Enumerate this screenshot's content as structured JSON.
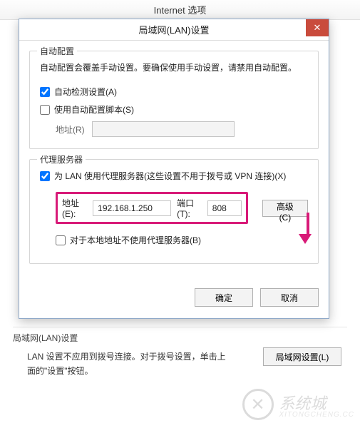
{
  "parent": {
    "title": "Internet 选项",
    "lan_section_label": "局域网(LAN)设置",
    "lan_desc": "LAN 设置不应用到拨号连接。对于拨号设置，单击上面的\"设置\"按钮。",
    "lan_button": "局域网设置(L)"
  },
  "dialog": {
    "title": "局域网(LAN)设置",
    "close": "✕",
    "auto": {
      "legend": "自动配置",
      "desc": "自动配置会覆盖手动设置。要确保使用手动设置，请禁用自动配置。",
      "detect_label": "自动检测设置(A)",
      "detect_checked": true,
      "script_label": "使用自动配置脚本(S)",
      "script_checked": false,
      "addr_label": "地址(R)",
      "addr_value": ""
    },
    "proxy": {
      "legend": "代理服务器",
      "enable_label": "为 LAN 使用代理服务器(这些设置不用于拨号或 VPN 连接)(X)",
      "enable_checked": true,
      "addr_label": "地址(E):",
      "addr_value": "192.168.1.250",
      "port_label": "端口(T):",
      "port_value": "808",
      "advanced_label": "高级(C)",
      "bypass_label": "对于本地地址不使用代理服务器(B)",
      "bypass_checked": false
    },
    "ok": "确定",
    "cancel": "取消"
  },
  "watermark": {
    "glyph": "✕",
    "text": "系统城",
    "sub": "XITONGCHENG.CC"
  },
  "colors": {
    "highlight": "#d81a78",
    "close_btn": "#c94b3c"
  }
}
